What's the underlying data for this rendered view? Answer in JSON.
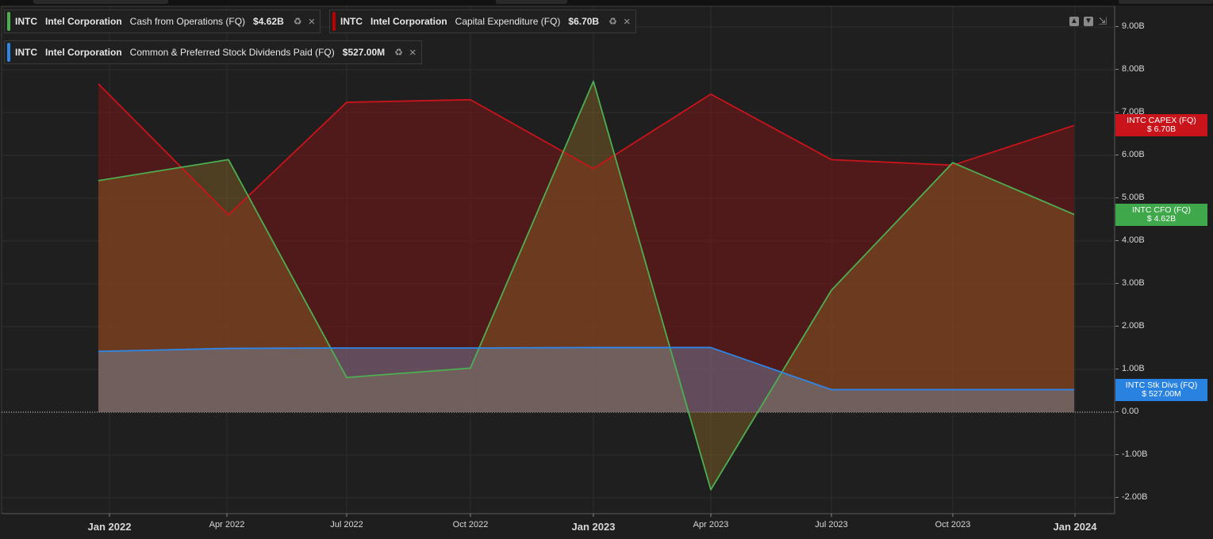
{
  "legend": [
    {
      "ticker": "INTC",
      "company": "Intel Corporation",
      "metric": "Cash from Operations (FQ)",
      "value": "$4.62B",
      "color": "#4caf50"
    },
    {
      "ticker": "INTC",
      "company": "Intel Corporation",
      "metric": "Capital Expenditure (FQ)",
      "value": "$6.70B",
      "color": "#c00000"
    },
    {
      "ticker": "INTC",
      "company": "Intel Corporation",
      "metric": "Common & Preferred Stock Dividends Paid (FQ)",
      "value": "$527.00M",
      "color": "#2e86e8"
    }
  ],
  "controls": {
    "up_icon": "arrow-up-icon",
    "down_icon": "arrow-down-icon",
    "shrink_icon": "collapse-icon"
  },
  "price_tags": [
    {
      "line1": "INTC CAPEX (FQ)",
      "line2": "$ 6.70B",
      "color": "#c8141a",
      "value": 6.7
    },
    {
      "line1": "INTC CFO (FQ)",
      "line2": "$ 4.62B",
      "color": "#3fa84a",
      "value": 4.62
    },
    {
      "line1": "INTC Stk Divs (FQ)",
      "line2": "$ 527.00M",
      "color": "#2a82e0",
      "value": 0.527
    }
  ],
  "chart_data": {
    "type": "area",
    "x_labels": [
      {
        "label": "Jan 2022",
        "major": true
      },
      {
        "label": "Apr 2022",
        "major": false
      },
      {
        "label": "Jul 2022",
        "major": false
      },
      {
        "label": "Oct 2022",
        "major": false
      },
      {
        "label": "Jan 2023",
        "major": true
      },
      {
        "label": "Apr 2023",
        "major": false
      },
      {
        "label": "Jul 2023",
        "major": false
      },
      {
        "label": "Oct 2023",
        "major": false
      },
      {
        "label": "Jan 2024",
        "major": true
      }
    ],
    "dates": [
      "2021-12-25",
      "2022-04-02",
      "2022-07-02",
      "2022-10-01",
      "2022-12-31",
      "2023-04-01",
      "2023-07-01",
      "2023-09-30",
      "2023-12-30"
    ],
    "y_ticks": [
      "9.00B",
      "8.00B",
      "7.00B",
      "6.00B",
      "5.00B",
      "4.00B",
      "3.00B",
      "2.00B",
      "1.00B",
      "0.00",
      "-1.00B",
      "-2.00B"
    ],
    "ylim": [
      -2.4,
      9.4
    ],
    "units": "B",
    "grid": true,
    "series": [
      {
        "name": "INTC CAPEX (FQ)",
        "color": "#c8141a",
        "fill": "rgba(120,20,22,0.55)",
        "values": [
          7.67,
          4.61,
          7.24,
          7.3,
          5.69,
          7.43,
          5.9,
          5.77,
          6.7
        ]
      },
      {
        "name": "INTC CFO (FQ)",
        "color": "#4caf50",
        "fill": "rgba(150,110,40,0.40)",
        "values": [
          5.41,
          5.9,
          0.81,
          1.03,
          7.73,
          -1.81,
          2.85,
          5.83,
          4.62
        ]
      },
      {
        "name": "INTC Stk Divs (FQ)",
        "color": "#2e86e8",
        "fill": "rgba(120,140,170,0.45)",
        "values": [
          1.42,
          1.49,
          1.5,
          1.5,
          1.51,
          1.51,
          0.527,
          0.527,
          0.527
        ]
      }
    ]
  }
}
